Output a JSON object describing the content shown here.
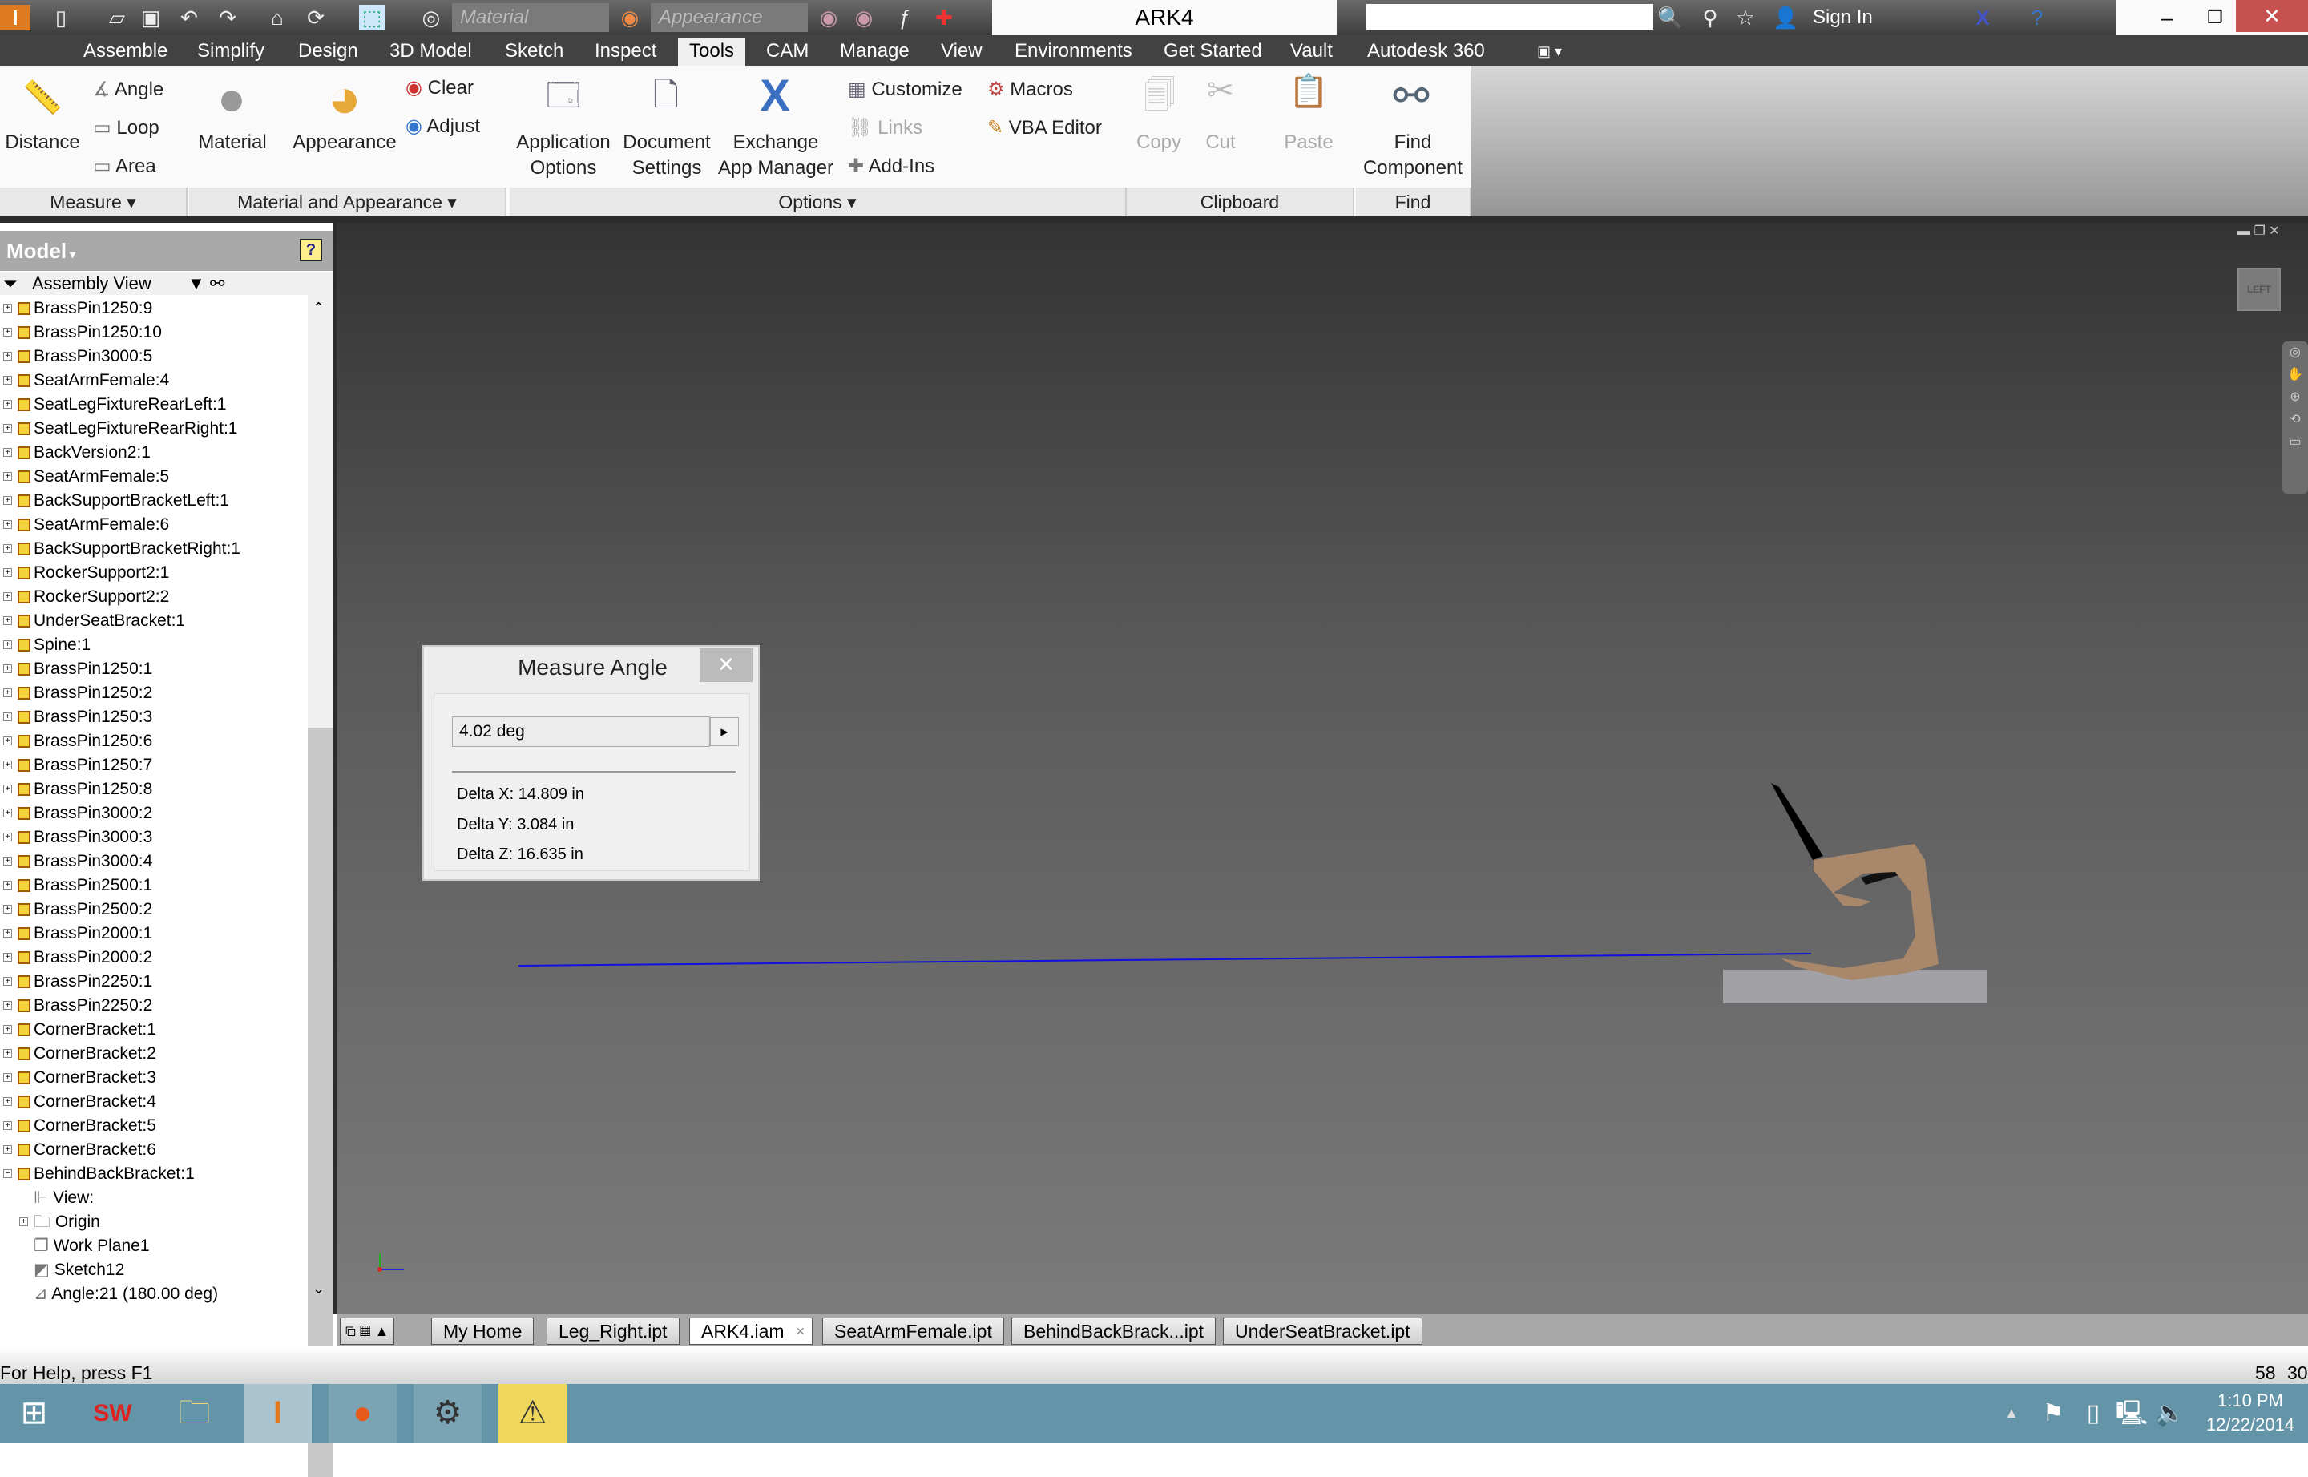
{
  "app": {
    "title": "ARK4",
    "material_placeholder": "Material",
    "appearance_placeholder": "Appearance",
    "sign_in": "Sign In"
  },
  "ribbon_tabs": [
    "Assemble",
    "Simplify",
    "Design",
    "3D Model",
    "Sketch",
    "Inspect",
    "Tools",
    "CAM",
    "Manage",
    "View",
    "Environments",
    "Get Started",
    "Vault",
    "Autodesk 360"
  ],
  "active_tab": "Tools",
  "panels": {
    "measure": {
      "label": "Measure ▾",
      "distance": "Distance",
      "angle": "Angle",
      "loop": "Loop",
      "area": "Area"
    },
    "material": {
      "label": "Material and Appearance ▾",
      "material": "Material",
      "appearance": "Appearance",
      "clear": "Clear",
      "adjust": "Adjust"
    },
    "options": {
      "label": "Options ▾",
      "app_options_1": "Application",
      "app_options_2": "Options",
      "doc_settings_1": "Document",
      "doc_settings_2": "Settings",
      "exchange_1": "Exchange",
      "exchange_2": "App Manager",
      "customize": "Customize",
      "links": "Links",
      "addins": "Add-Ins",
      "macros": "Macros",
      "vba": "VBA Editor"
    },
    "clipboard": {
      "label": "Clipboard",
      "copy": "Copy",
      "cut": "Cut",
      "paste": "Paste"
    },
    "find": {
      "label": "Find",
      "find_1": "Find",
      "find_2": "Component"
    }
  },
  "browser": {
    "title": "Model",
    "view": "Assembly View",
    "items": [
      "BrassPin1250:9",
      "BrassPin1250:10",
      "BrassPin3000:5",
      "SeatArmFemale:4",
      "SeatLegFixtureRearLeft:1",
      "SeatLegFixtureRearRight:1",
      "BackVersion2:1",
      "SeatArmFemale:5",
      "BackSupportBracketLeft:1",
      "SeatArmFemale:6",
      "BackSupportBracketRight:1",
      "RockerSupport2:1",
      "RockerSupport2:2",
      "UnderSeatBracket:1",
      "Spine:1",
      "BrassPin1250:1",
      "BrassPin1250:2",
      "BrassPin1250:3",
      "BrassPin1250:6",
      "BrassPin1250:7",
      "BrassPin1250:8",
      "BrassPin3000:2",
      "BrassPin3000:3",
      "BrassPin3000:4",
      "BrassPin2500:1",
      "BrassPin2500:2",
      "BrassPin2000:1",
      "BrassPin2000:2",
      "BrassPin2250:1",
      "BrassPin2250:2",
      "CornerBracket:1",
      "CornerBracket:2",
      "CornerBracket:3",
      "CornerBracket:4",
      "CornerBracket:5",
      "CornerBracket:6",
      "BehindBackBracket:1"
    ],
    "children": [
      "View:",
      "Origin",
      "Work Plane1",
      "Sketch12",
      "Angle:21 (180.00 deg)"
    ]
  },
  "viewcube": "LEFT",
  "dialog": {
    "title": "Measure Angle",
    "value": "4.02 deg",
    "dx": "Delta X: 14.809 in",
    "dy": "Delta Y: 3.084 in",
    "dz": "Delta Z: 16.635 in"
  },
  "doc_tabs": [
    "My Home",
    "Leg_Right.ipt",
    "ARK4.iam",
    "SeatArmFemale.ipt",
    "BehindBackBrack...ipt",
    "UnderSeatBracket.ipt"
  ],
  "active_doc": "ARK4.iam",
  "status": {
    "help": "For Help, press F1",
    "n1": "58",
    "n2": "30"
  },
  "clock": {
    "time": "1:10 PM",
    "date": "12/22/2014"
  }
}
